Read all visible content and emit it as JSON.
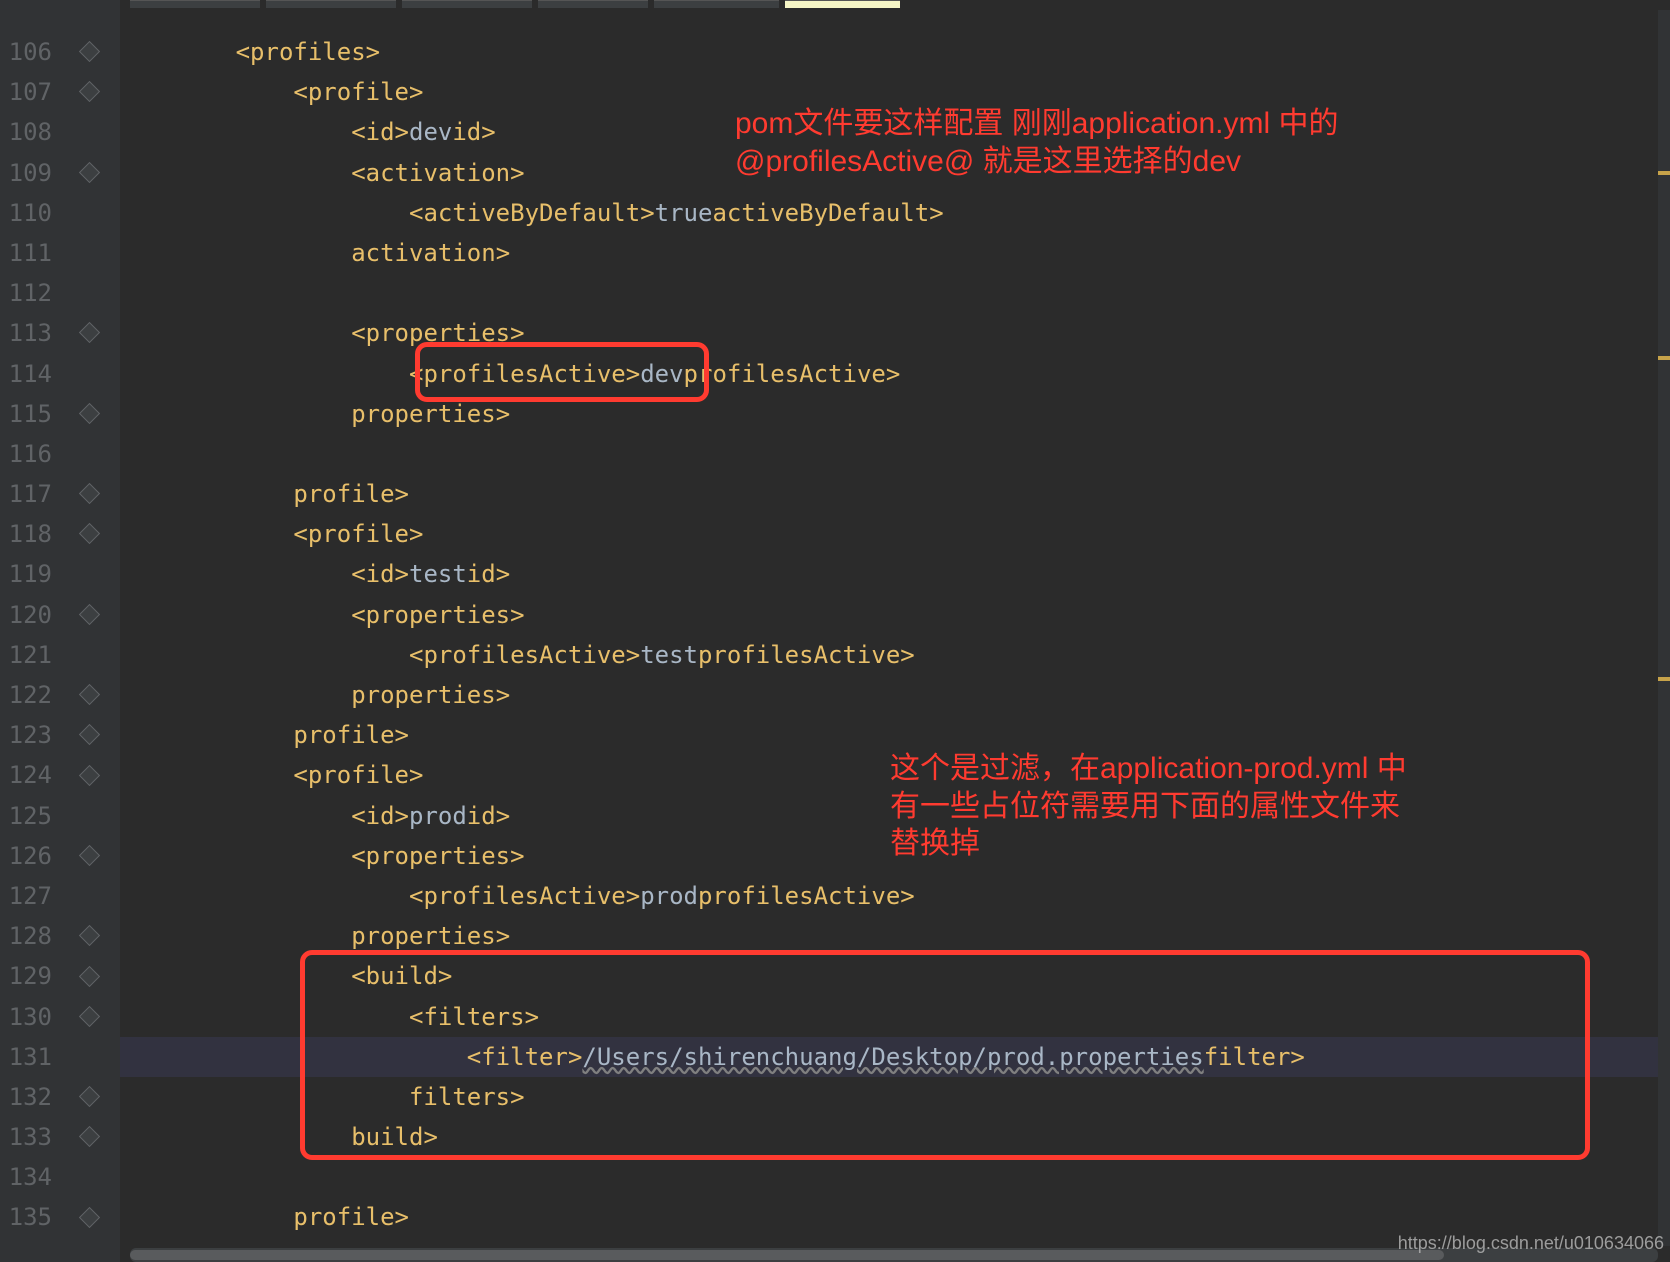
{
  "watermark": "https://blog.csdn.net/u010634066",
  "annotations": {
    "a1": "pom文件要这样配置   刚刚application.yml 中的\n@profilesActive@ 就是这里选择的dev",
    "a2": "这个是过滤，在application-prod.yml 中\n有一些占位符需要用下面的属性文件来\n替换掉"
  },
  "startLine": 106,
  "endLine": 135,
  "lineNumbers": [
    "106",
    "107",
    "108",
    "109",
    "110",
    "111",
    "112",
    "113",
    "114",
    "115",
    "116",
    "117",
    "118",
    "119",
    "120",
    "121",
    "122",
    "123",
    "124",
    "125",
    "126",
    "127",
    "128",
    "129",
    "130",
    "131",
    "132",
    "133",
    "134",
    "135"
  ],
  "foldAt": [
    106,
    107,
    109,
    113,
    115,
    117,
    118,
    120,
    122,
    123,
    124,
    126,
    128,
    129,
    130,
    132,
    133,
    135
  ],
  "highlightedLine": 131,
  "code": {
    "106": {
      "indent": "        ",
      "open": "<",
      "tag": "profiles",
      "close": ">"
    },
    "107": {
      "indent": "            ",
      "open": "<",
      "tag": "profile",
      "close": ">"
    },
    "108": {
      "indent": "                ",
      "open": "<",
      "tag": "id",
      "close": ">",
      "text": "dev",
      "open2": "</",
      "tag2": "id",
      "close2": ">"
    },
    "109": {
      "indent": "                ",
      "open": "<",
      "tag": "activation",
      "close": ">"
    },
    "110": {
      "indent": "                    ",
      "open": "<",
      "tag": "activeByDefault",
      "close": ">",
      "text": "true",
      "open2": "</",
      "tag2": "activeByDefault",
      "close2": ">"
    },
    "111": {
      "indent": "                ",
      "open": "</",
      "tag": "activation",
      "close": ">"
    },
    "112": {
      "indent": ""
    },
    "113": {
      "indent": "                ",
      "open": "<",
      "tag": "properties",
      "close": ">"
    },
    "114": {
      "indent": "                    ",
      "open": "<",
      "tag": "profilesActive",
      "close": ">",
      "text": "dev",
      "open2": "</",
      "tag2": "profilesActive",
      "close2": ">"
    },
    "115": {
      "indent": "                ",
      "open": "</",
      "tag": "properties",
      "close": ">"
    },
    "116": {
      "indent": ""
    },
    "117": {
      "indent": "            ",
      "open": "</",
      "tag": "profile",
      "close": ">"
    },
    "118": {
      "indent": "            ",
      "open": "<",
      "tag": "profile",
      "close": ">"
    },
    "119": {
      "indent": "                ",
      "open": "<",
      "tag": "id",
      "close": ">",
      "text": "test",
      "open2": "</",
      "tag2": "id",
      "close2": ">"
    },
    "120": {
      "indent": "                ",
      "open": "<",
      "tag": "properties",
      "close": ">"
    },
    "121": {
      "indent": "                    ",
      "open": "<",
      "tag": "profilesActive",
      "close": ">",
      "text": "test",
      "open2": "</",
      "tag2": "profilesActive",
      "close2": ">"
    },
    "122": {
      "indent": "                ",
      "open": "</",
      "tag": "properties",
      "close": ">"
    },
    "123": {
      "indent": "            ",
      "open": "</",
      "tag": "profile",
      "close": ">"
    },
    "124": {
      "indent": "            ",
      "open": "<",
      "tag": "profile",
      "close": ">"
    },
    "125": {
      "indent": "                ",
      "open": "<",
      "tag": "id",
      "close": ">",
      "text": "prod",
      "open2": "</",
      "tag2": "id",
      "close2": ">"
    },
    "126": {
      "indent": "                ",
      "open": "<",
      "tag": "properties",
      "close": ">"
    },
    "127": {
      "indent": "                    ",
      "open": "<",
      "tag": "profilesActive",
      "close": ">",
      "text": "prod",
      "open2": "</",
      "tag2": "profilesActive",
      "close2": ">"
    },
    "128": {
      "indent": "                ",
      "open": "</",
      "tag": "properties",
      "close": ">"
    },
    "129": {
      "indent": "                ",
      "open": "<",
      "tag": "build",
      "close": ">"
    },
    "130": {
      "indent": "                    ",
      "open": "<",
      "tag": "filters",
      "close": ">"
    },
    "131": {
      "indent": "                        ",
      "open": "<",
      "tag": "filter",
      "close": ">",
      "text": "/Users/shirenchuang/Desktop/prod.properties",
      "open2": "</",
      "tag2": "filter",
      "close2": ">",
      "underline": true
    },
    "132": {
      "indent": "                    ",
      "open": "</",
      "tag": "filters",
      "close": ">"
    },
    "133": {
      "indent": "                ",
      "open": "</",
      "tag": "build",
      "close": ">"
    },
    "134": {
      "indent": ""
    },
    "135": {
      "indent": "            ",
      "open": "</",
      "tag": "profile",
      "close": ">"
    }
  }
}
